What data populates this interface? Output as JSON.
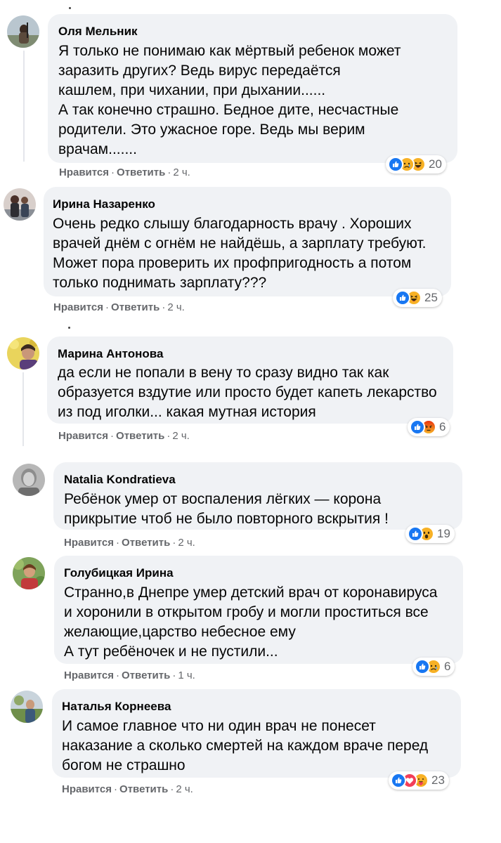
{
  "actions": {
    "like_label": "Нравится",
    "reply_label": "Ответить",
    "separator": "·"
  },
  "comments": [
    {
      "author": "Оля Мельник",
      "text": "Я только не понимаю как мёртвый ребенок может\nзаразить других? Ведь вирус передаётся\nкашлем, при чихании, при дыхании......\nА так конечно страшно. Бедное дите, несчастные\nродители. Это ужасное горе. Ведь мы верим\nврачам.......",
      "time": "2 ч.",
      "reactions": [
        "like-icon",
        "sad-icon",
        "haha-icon"
      ],
      "reaction_count": "20"
    },
    {
      "author": "Ирина Назаренко",
      "text": "Очень редко слышу благодарность врачу . Хороших\nврачей днём с огнём не найдёшь, а зарплату требуют.\nМожет пора проверить их профпригодность а потом\nтолько поднимать зарплату???",
      "time": "2 ч.",
      "reactions": [
        "like-icon",
        "haha-icon"
      ],
      "reaction_count": "25"
    },
    {
      "author": "Марина Антонова",
      "text": "да если не попали в вену то сразу видно так как\nобразуется вздутие или просто будет капеть лекарство\nиз под иголки... какая мутная история",
      "time": "2 ч.",
      "reactions": [
        "like-icon",
        "angry-icon"
      ],
      "reaction_count": "6"
    },
    {
      "author": "Natalia Kondratieva",
      "text": "Ребёнок умер от воспаления лёгких — корона\nприкрытие чтоб не было повторного вскрытия !",
      "time": "2 ч.",
      "reactions": [
        "like-icon",
        "wow-icon"
      ],
      "reaction_count": "19"
    },
    {
      "author": "Голубицкая Ирина",
      "text": "Странно,в Днепре умер детский врач от коронавируса\nи хоронили в открытом гробу и могли проститься все\nжелающие,царство небесное ему\nА тут ребёночек и не пустили...",
      "time": "1 ч.",
      "reactions": [
        "like-icon",
        "sad-icon"
      ],
      "reaction_count": "6"
    },
    {
      "author": "Наталья Корнеева",
      "text": "И самое главное что ни один врач не понесет\nнаказание а сколько смертей на каждом враче перед\nбогом не страшно",
      "time": "2 ч.",
      "reactions": [
        "like-icon",
        "love-icon",
        "care-icon"
      ],
      "reaction_count": "23"
    }
  ],
  "colors": {
    "bubble": "#f0f2f5",
    "meta_text": "#65676b",
    "like_blue": "#1877f2",
    "sad_yellow": "#f7b125",
    "angry_orange": "#e9710f",
    "love_red": "#f33e58"
  }
}
